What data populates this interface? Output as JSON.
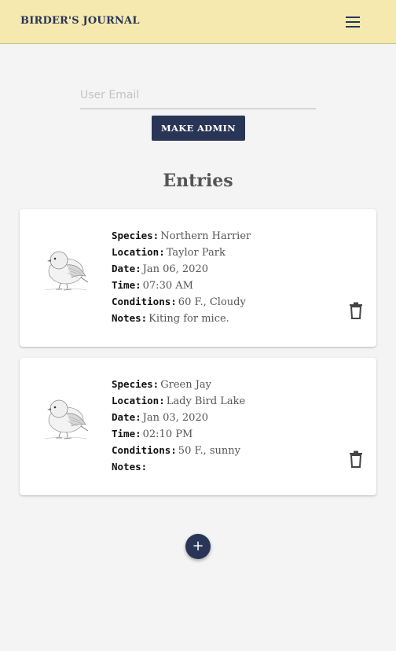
{
  "header": {
    "title": "BIRDER'S JOURNAL",
    "menu_icon": "hamburger-menu-icon"
  },
  "admin": {
    "email_placeholder": "User Email",
    "email_value": "",
    "button_label": "MAKE ADMIN"
  },
  "entries_title": "Entries",
  "labels": {
    "species": "Species:",
    "location": "Location:",
    "date": "Date:",
    "time": "Time:",
    "conditions": "Conditions:",
    "notes": "Notes:"
  },
  "entries": [
    {
      "species": "Northern Harrier",
      "location": "Taylor Park",
      "date": "Jan 06, 2020",
      "time": "07:30 AM",
      "conditions": "60 F., Cloudy",
      "notes": "Kiting for mice.",
      "image_icon": "bird-sketch-icon",
      "delete_icon": "trash-icon"
    },
    {
      "species": "Green Jay",
      "location": "Lady Bird Lake",
      "date": "Jan 03, 2020",
      "time": "02:10 PM",
      "conditions": "50 F., sunny",
      "notes": "",
      "image_icon": "bird-sketch-icon",
      "delete_icon": "trash-icon"
    }
  ],
  "add_button": {
    "label": "+",
    "icon": "plus-icon"
  },
  "colors": {
    "appbar": "#f5e9b0",
    "primary": "#283556",
    "background": "#f4f4f4",
    "card": "#ffffff"
  }
}
